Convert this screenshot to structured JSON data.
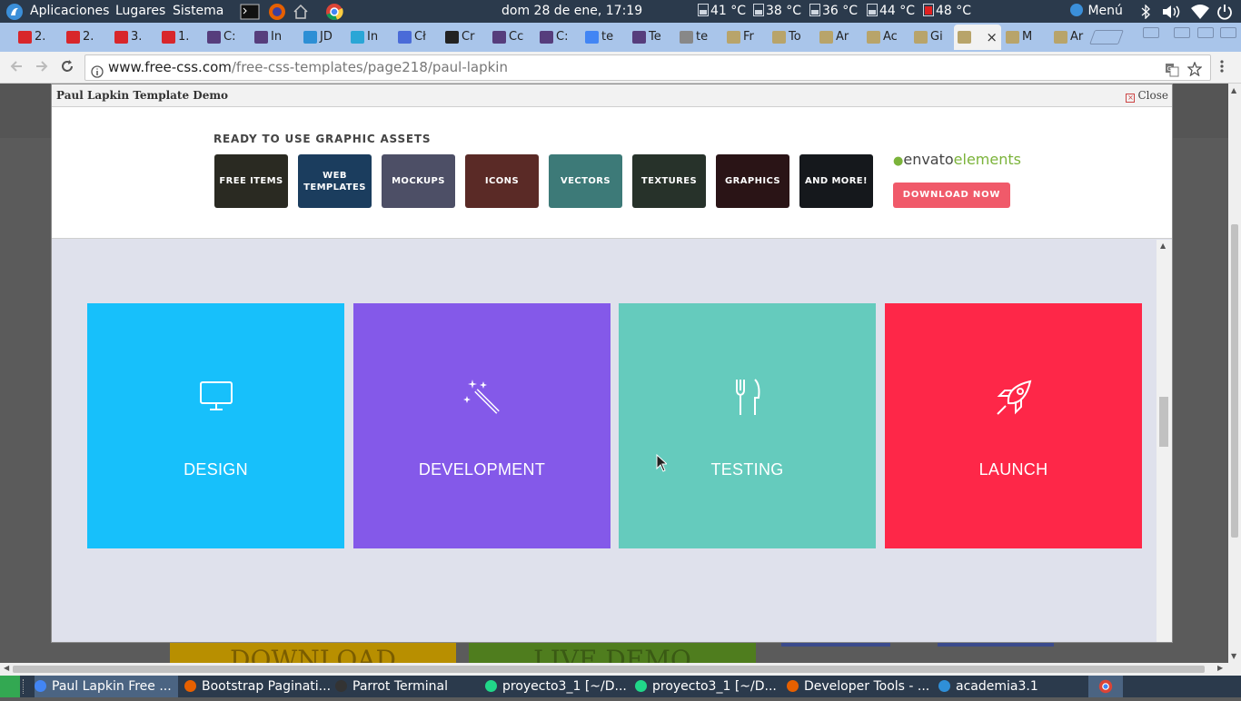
{
  "system_bar": {
    "applications": "Aplicaciones",
    "places": "Lugares",
    "system": "Sistema",
    "clock": "dom 28 de ene, 17:19",
    "temps": [
      "41 °C",
      "38 °C",
      "36 °C",
      "44 °C",
      "48 °C"
    ],
    "menu": "Menú"
  },
  "tabs": [
    {
      "label": "2.",
      "icon": "book-icon",
      "color": "#d8262b"
    },
    {
      "label": "2.",
      "icon": "book-icon",
      "color": "#d8262b"
    },
    {
      "label": "3.",
      "icon": "book-icon",
      "color": "#d8262b"
    },
    {
      "label": "1.",
      "icon": "book-icon",
      "color": "#d8262b"
    },
    {
      "label": "C:",
      "icon": "bootstrap-icon",
      "color": "#563d7c"
    },
    {
      "label": "In",
      "icon": "bootstrap-icon",
      "color": "#563d7c"
    },
    {
      "label": "JD",
      "icon": "jdk-icon",
      "color": "#2d8fd5"
    },
    {
      "label": "In",
      "icon": "info-icon",
      "color": "#2aa6d6"
    },
    {
      "label": "Cł",
      "icon": "grid-icon",
      "color": "#4a6bd8"
    },
    {
      "label": "Cr",
      "icon": "bow-icon",
      "color": "#222222"
    },
    {
      "label": "Cc",
      "icon": "bootstrap-icon",
      "color": "#563d7c"
    },
    {
      "label": "C:",
      "icon": "bootstrap-icon",
      "color": "#563d7c"
    },
    {
      "label": "te",
      "icon": "google-icon",
      "color": "#4285f4"
    },
    {
      "label": "Te",
      "icon": "bootstrap-icon",
      "color": "#563d7c"
    },
    {
      "label": "te",
      "icon": "wiki-icon",
      "color": "#888888"
    },
    {
      "label": "Fr",
      "icon": "css-icon",
      "color": "#b8a46a"
    },
    {
      "label": "To",
      "icon": "css-icon",
      "color": "#b8a46a"
    },
    {
      "label": "Ar",
      "icon": "css-icon",
      "color": "#b8a46a"
    },
    {
      "label": "Ac",
      "icon": "css-icon",
      "color": "#b8a46a"
    },
    {
      "label": "Gi",
      "icon": "css-icon",
      "color": "#b8a46a"
    },
    {
      "label": "",
      "icon": "css-icon",
      "color": "#b8a46a",
      "active": true
    },
    {
      "label": "M",
      "icon": "css-icon",
      "color": "#b8a46a"
    },
    {
      "label": "Ar",
      "icon": "css-icon",
      "color": "#b8a46a"
    }
  ],
  "address_bar": {
    "url_host": "www.free-css.com",
    "url_path": "/free-css-templates/page218/paul-lapkin"
  },
  "modal": {
    "title": "Paul Lapkin Template Demo",
    "close_label": "Close"
  },
  "ad": {
    "heading": "READY TO USE GRAPHIC ASSETS",
    "tiles": [
      {
        "label": "FREE ITEMS",
        "color": "#2a2a22"
      },
      {
        "label": "WEB TEMPLATES",
        "color": "#1b3d5e"
      },
      {
        "label": "MOCKUPS",
        "color": "#4d4f66"
      },
      {
        "label": "ICONS",
        "color": "#5a2a26"
      },
      {
        "label": "VECTORS",
        "color": "#3d7a78"
      },
      {
        "label": "TEXTURES",
        "color": "#27322a"
      },
      {
        "label": "GRAPHICS",
        "color": "#2a1416"
      },
      {
        "label": "AND MORE!",
        "color": "#15181c"
      }
    ],
    "brand_prefix": "envato",
    "brand_suffix": "elements",
    "download_label": "DOWNLOAD NOW"
  },
  "cards": [
    {
      "label": "DESIGN",
      "icon": "monitor-icon",
      "color": "#17c0fb"
    },
    {
      "label": "DEVELOPMENT",
      "icon": "magic-wand-icon",
      "color": "#8459e9"
    },
    {
      "label": "TESTING",
      "icon": "fork-knife-icon",
      "color": "#65cbbd"
    },
    {
      "label": "LAUNCH",
      "icon": "rocket-icon",
      "color": "#fe2748"
    }
  ],
  "background_buttons": {
    "download": "DOWNLOAD",
    "live_demo": "LIVE DEMO"
  },
  "taskbar": [
    {
      "label": "Paul Lapkin Free ...",
      "color": "#4285f4"
    },
    {
      "label": "Bootstrap Paginati...",
      "color": "#e66000"
    },
    {
      "label": "Parrot Terminal",
      "color": "#333333"
    },
    {
      "label": "proyecto3_1 [~/D...",
      "color": "#21d789"
    },
    {
      "label": "proyecto3_1 [~/D...",
      "color": "#21d789"
    },
    {
      "label": "Developer Tools - ...",
      "color": "#e66000"
    },
    {
      "label": "academia3.1",
      "color": "#2f8fd8"
    }
  ]
}
